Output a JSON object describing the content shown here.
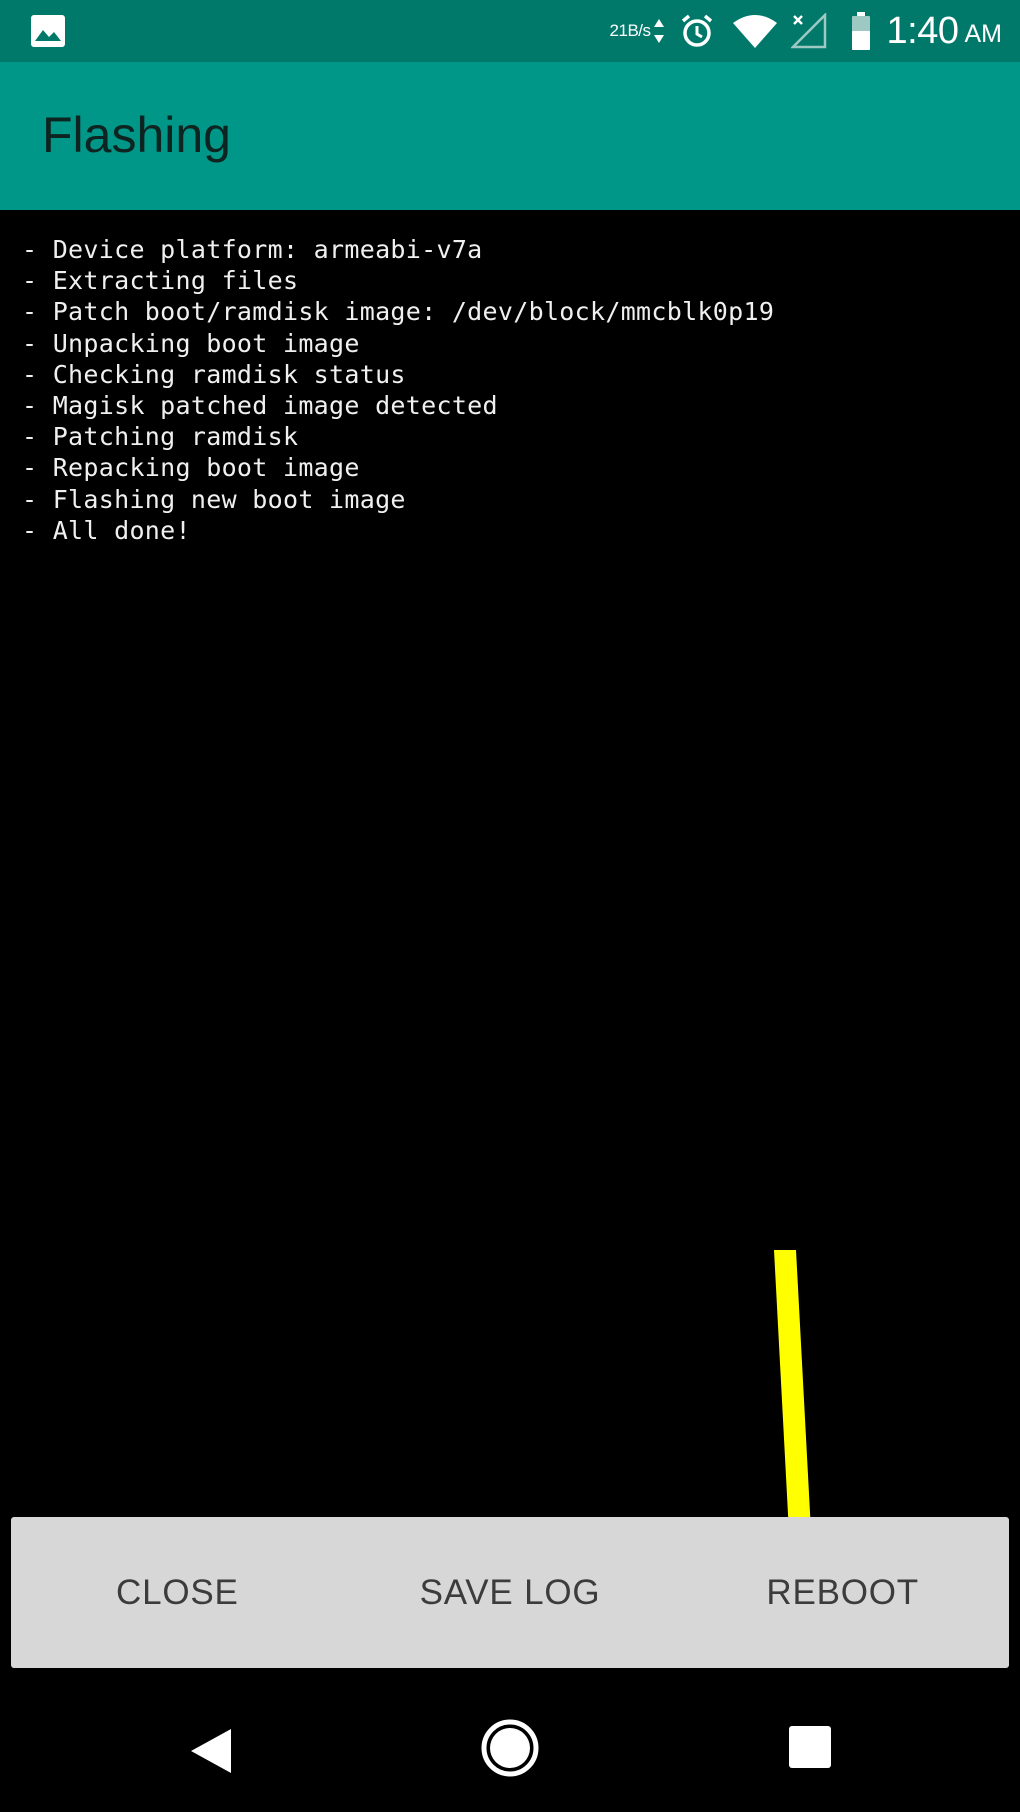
{
  "status_bar": {
    "net_speed": "21B/s",
    "time": "1:40",
    "ampm": "AM",
    "icons": [
      "gallery-icon",
      "data-arrows-icon",
      "alarm-icon",
      "wifi-icon",
      "signal-icon",
      "battery-icon"
    ]
  },
  "app_bar": {
    "title": "Flashing"
  },
  "log": {
    "lines": [
      "- Device platform: armeabi-v7a",
      "- Extracting files",
      "- Patch boot/ramdisk image: /dev/block/mmcblk0p19",
      "- Unpacking boot image",
      "- Checking ramdisk status",
      "- Magisk patched image detected",
      "- Patching ramdisk",
      "- Repacking boot image",
      "- Flashing new boot image",
      "- All done!"
    ]
  },
  "buttons": {
    "close": "CLOSE",
    "save_log": "SAVE LOG",
    "reboot": "REBOOT"
  },
  "navigation": {
    "icons": [
      "back-icon",
      "home-icon",
      "recents-icon"
    ]
  },
  "colors": {
    "status_bar": "#00796b",
    "app_bar": "#009688",
    "console_bg": "#000000",
    "console_text": "#f0f0f0",
    "button_bar": "#d6d7d6",
    "annotation_arrow": "#ffff00"
  }
}
